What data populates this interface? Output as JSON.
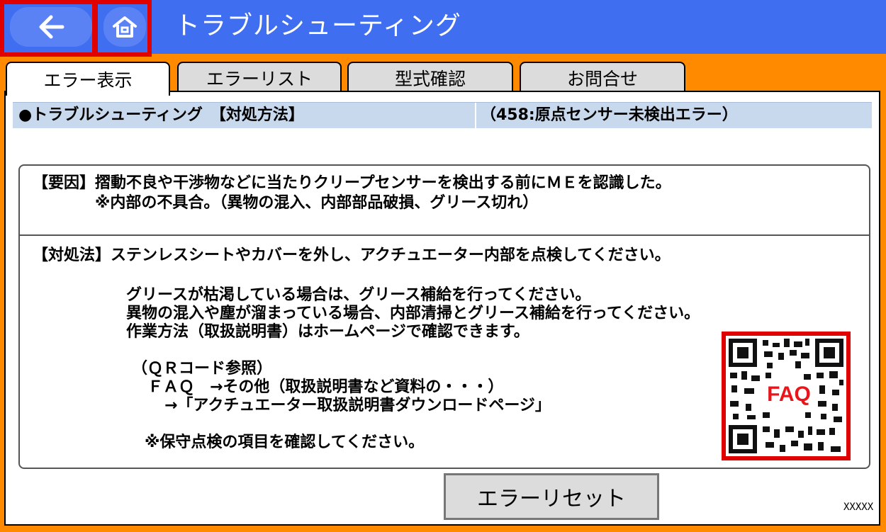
{
  "header": {
    "title": "トラブルシューティング",
    "back_icon": "arrow-left-icon",
    "home_icon": "home-icon"
  },
  "tabs": [
    {
      "label": "エラー表示",
      "active": true
    },
    {
      "label": "エラーリスト",
      "active": false
    },
    {
      "label": "型式確認",
      "active": false
    },
    {
      "label": "お問合せ",
      "active": false
    }
  ],
  "section": {
    "left": "●トラブルシューティング　【対処方法】",
    "right": "（458:原点センサー未検出エラー）"
  },
  "cause": {
    "line1": "【要因】摺動不良や干渉物などに当たりクリープセンサーを検出する前にＭＥを認識した。",
    "line2": "　　　　※内部の不具合。（異物の混入、内部部品破損、グリース切れ）"
  },
  "remedy": {
    "line1": "【対処法】ステンレスシートやカバーを外し、アクチュエーター内部を点検してください。",
    "line2": "グリースが枯渇している場合は、グリース補給を行ってください。",
    "line3": "異物の混入や塵が溜まっている場合、内部清掃とグリース補給を行ってください。",
    "line4": "作業方法（取扱説明書）はホームページで確認できます。",
    "line5": "（ＱＲコード参照）",
    "line6": "ＦＡＱ　→その他（取扱説明書など資料の・・・）",
    "line7": "→「アクチュエーター取扱説明書ダウンロードページ」",
    "line8": "※保守点検の項目を確認してください。"
  },
  "qr": {
    "label": "FAQ",
    "icon": "qr-code-icon"
  },
  "reset_button": "エラーリセット",
  "version": "XXXXX",
  "colors": {
    "topbar": "#3f6ef0",
    "background": "#ff8a00",
    "highlight": "#e00000"
  }
}
